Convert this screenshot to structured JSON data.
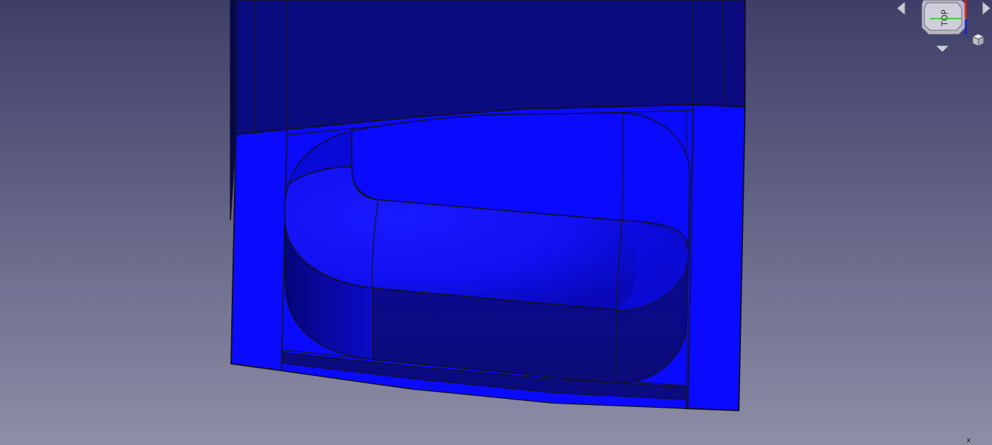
{
  "viewport": {
    "background_top": "#3f3f6b",
    "background_bottom": "#8d8da6"
  },
  "model": {
    "light_face_color": "#0a0aff",
    "dark_face_color": "#0b0b80",
    "edge_color": "#111122"
  },
  "navcube": {
    "face_label": "TOP",
    "axis_colors": {
      "x": "#d22020",
      "y": "#20c020",
      "z": "#2020d0"
    }
  },
  "axis_indicator": {
    "label": "x"
  }
}
